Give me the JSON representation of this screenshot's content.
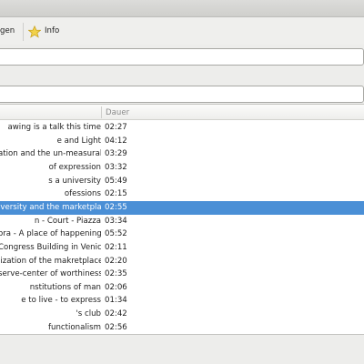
{
  "toolbar": {
    "partial_button_label": "gen",
    "info_button_label": "Info",
    "info_icon": "star-icon",
    "info_icon_color": "#f2d24a"
  },
  "list": {
    "column_duration": "Dauer",
    "selected_color": "#4a8fd6",
    "rows": [
      {
        "title": "awing is a talk this time",
        "duration": "02:27"
      },
      {
        "title": "e and Light",
        "duration": "04:12"
      },
      {
        "title": "ation and the un-measurable",
        "duration": "03:29"
      },
      {
        "title": "of expression",
        "duration": "03:32"
      },
      {
        "title": "s a university",
        "duration": "05:49"
      },
      {
        "title": "ofessions",
        "duration": "02:15"
      },
      {
        "title": "iversity and the marketplace",
        "duration": "02:55",
        "selected": true
      },
      {
        "title": "n - Court - Piazza",
        "duration": "03:34"
      },
      {
        "title": "ora - A place of happening",
        "duration": "05:52"
      },
      {
        "title": "Congress Building in Venice",
        "duration": "02:11"
      },
      {
        "title": "lization of the makretplace",
        "duration": "02:20"
      },
      {
        "title": "serve-center of worthiness",
        "duration": "02:35"
      },
      {
        "title": "nstitutions of man",
        "duration": "02:06"
      },
      {
        "title": "e to live - to express",
        "duration": "01:34"
      },
      {
        "title": "'s club",
        "duration": "02:42"
      },
      {
        "title": "functionalism",
        "duration": "02:56"
      }
    ]
  }
}
